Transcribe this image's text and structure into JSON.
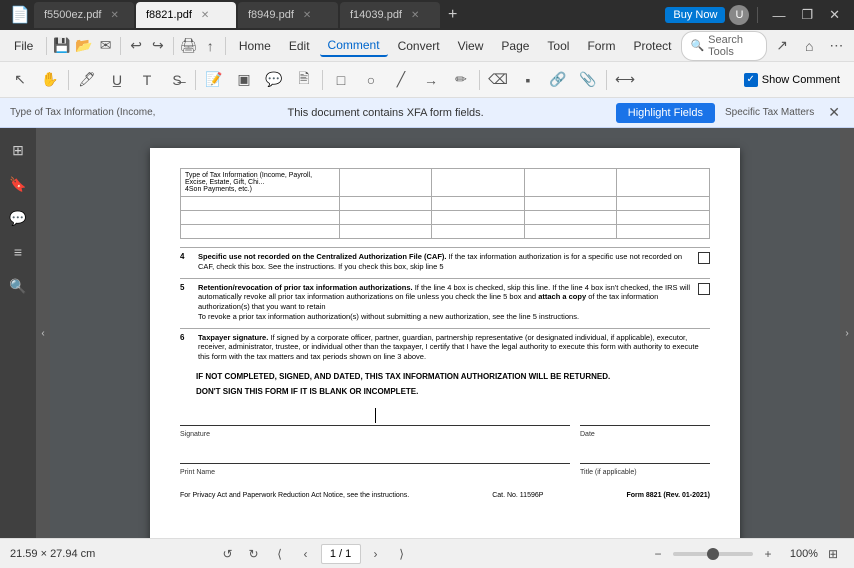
{
  "titlebar": {
    "tabs": [
      {
        "id": "tab1",
        "label": "f5500ez.pdf",
        "active": false
      },
      {
        "id": "tab2",
        "label": "f8821.pdf",
        "active": true
      },
      {
        "id": "tab3",
        "label": "f8949.pdf",
        "active": false
      },
      {
        "id": "tab4",
        "label": "f14039.pdf",
        "active": false
      }
    ],
    "add_tab": "+",
    "buy_now": "Buy Now",
    "minimize": "—",
    "restore": "❐",
    "close": "✕"
  },
  "menubar": {
    "file": "File",
    "home": "Home",
    "edit": "Edit",
    "comment": "Comment",
    "convert": "Convert",
    "view": "View",
    "page": "Page",
    "tool": "Tool",
    "form": "Form",
    "protect": "Protect",
    "search_placeholder": "Search Tools"
  },
  "toolbar": {
    "show_comment_label": "Show Comment"
  },
  "xfa_bar": {
    "left_label1": "Type of Tax Information (Income,",
    "left_label2": "Payroll, Excise, Estate, Gift, Chi...",
    "left_label3": "4Son Payments, etc.)",
    "message": "This document contains XFA form fields.",
    "highlight_btn": "Highlight Fields",
    "specific_tax": "Specific Tax Matters",
    "close": "✕"
  },
  "pdf": {
    "item4": {
      "number": "4",
      "bold_text": "Specific use not recorded on the Centralized Authorization File (CAF).",
      "text": "If the tax information authorization is for a specific use not recorded on CAF, check this box. See the instructions. If you check this box, skip line 5"
    },
    "item5": {
      "number": "5",
      "bold_text": "Retention/revocation of prior tax information authorizations.",
      "text1": "If the line 4 box is checked, skip this line. If the line 4 box isn't checked, the IRS will automatically revoke all prior tax information authorizations on file unless you check the line 5 box and",
      "bold_attach": "attach a copy",
      "text2": "of the tax information authorization(s) that you want to retain",
      "text3": "To revoke a prior tax information authorization(s) without submitting a new authorization, see the line 5 instructions."
    },
    "item6": {
      "number": "6",
      "bold_text": "Taxpayer signature.",
      "text": "If signed by a corporate officer, partner, guardian, partnership representative (or designated individual, if applicable), executor, receiver, administrator, trustee, or individual other than the taxpayer, I certify that I have the legal authority to execute this form with authority to execute this form with the tax matters and tax periods shown on line 3 above."
    },
    "warning1": "IF NOT COMPLETED, SIGNED, AND DATED, THIS TAX INFORMATION AUTHORIZATION WILL BE RETURNED.",
    "warning2": "DON'T SIGN THIS FORM IF IT IS BLANK OR INCOMPLETE.",
    "signature_label": "Signature",
    "date_label": "Date",
    "print_name_label": "Print Name",
    "title_label": "Title (if applicable)",
    "privacy_notice": "For Privacy Act and Paperwork Reduction Act Notice, see the instructions.",
    "cat_no": "Cat. No. 11596P",
    "form_ref": "Form 8821 (Rev. 01-2021)"
  },
  "bottom_bar": {
    "page_size": "21.59 × 27.94 cm",
    "page_nav": "1 / 1",
    "zoom_percent": "100%"
  },
  "sidebar": {
    "icons": [
      "☰",
      "🔖",
      "💬",
      "📋",
      "🔍"
    ]
  }
}
